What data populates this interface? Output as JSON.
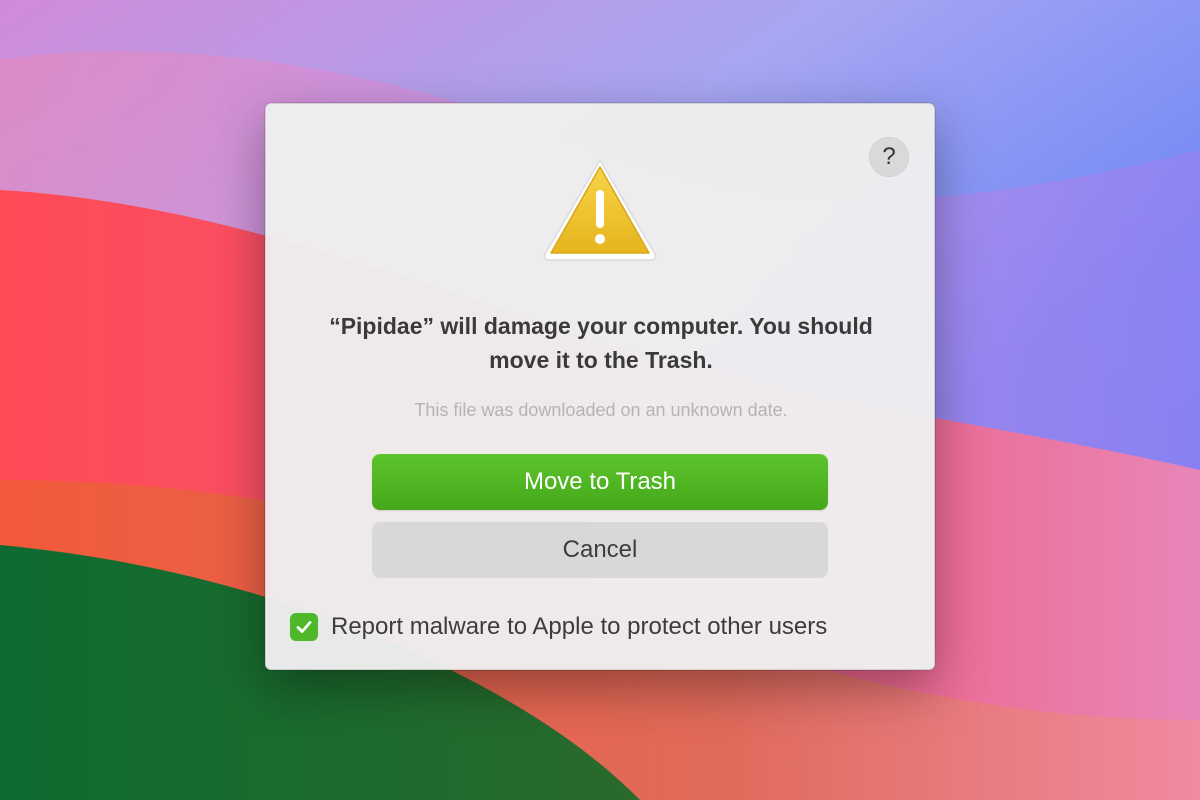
{
  "dialog": {
    "help_label": "?",
    "icon": "warning-triangle-icon",
    "headline": "“Pipidae” will damage your computer. You should move it to the Trash.",
    "subtext": "This file was downloaded on an unknown date.",
    "primary_button": "Move to Trash",
    "secondary_button": "Cancel",
    "report_checkbox": {
      "checked": true,
      "label": "Report malware to Apple to protect other users"
    }
  },
  "colors": {
    "primary_button": "#4fb324",
    "checkbox": "#4fb82a",
    "warning_icon": "#f2c531"
  }
}
